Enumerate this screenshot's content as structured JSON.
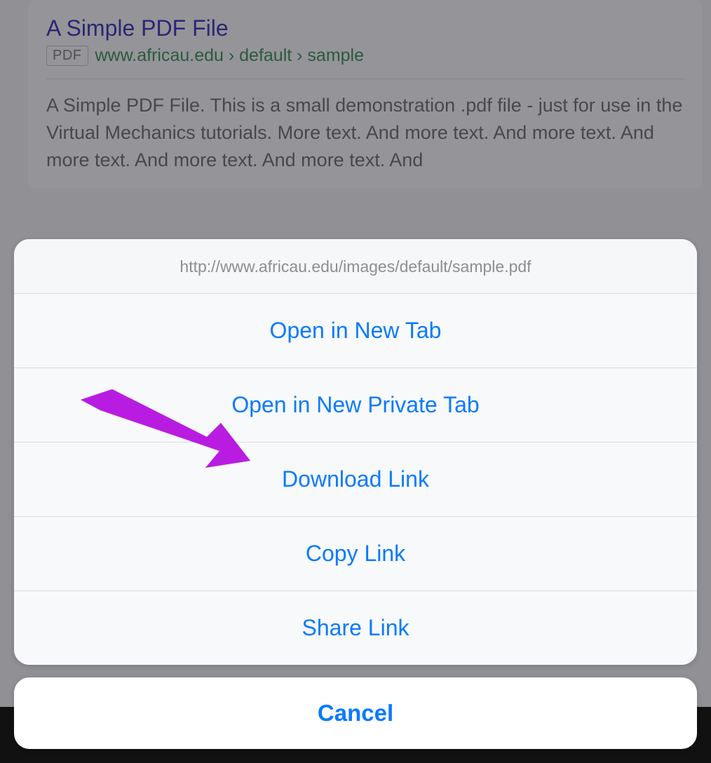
{
  "search_result": {
    "title": "A Simple PDF File",
    "badge": "PDF",
    "url_display": "www.africau.edu › default › sample",
    "snippet": "A Simple PDF File. This is a small demonstration .pdf file - just for use in the Virtual Mechanics tutorials. More text. And more text. And more text. And more text. And more text. And more text. And"
  },
  "action_sheet": {
    "url": "http://www.africau.edu/images/default/sample.pdf",
    "options": [
      "Open in New Tab",
      "Open in New Private Tab",
      "Download Link",
      "Copy Link",
      "Share Link"
    ],
    "cancel": "Cancel"
  },
  "annotation": {
    "arrow_color": "#b81be0"
  }
}
